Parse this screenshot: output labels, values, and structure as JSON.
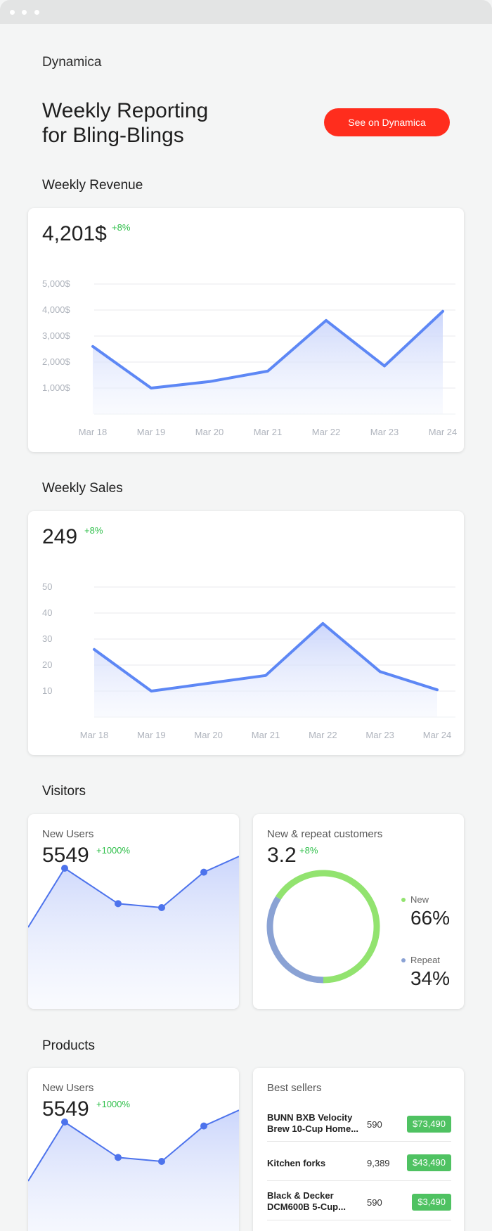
{
  "brand": "Dynamica",
  "headline": {
    "line1": "Weekly Reporting",
    "line2": "for Bling-Blings"
  },
  "cta_label": "See on Dynamica",
  "colors": {
    "accent": "#ff2d1d",
    "line": "#5d87f5",
    "positive": "#2fbf4a",
    "donut_new": "#92e36f",
    "donut_repeat": "#8aa2d4",
    "badge": "#4fc262"
  },
  "revenue": {
    "title": "Weekly Revenue",
    "value": "4,201$",
    "delta": "+8%"
  },
  "sales": {
    "title": "Weekly Sales",
    "value": "249",
    "delta": "+8%"
  },
  "visitors": {
    "title": "Visitors",
    "new_users": {
      "label": "New Users",
      "value": "5549",
      "delta": "+1000%"
    },
    "customers": {
      "label": "New & repeat customers",
      "value": "3.2",
      "delta": "+8%",
      "new_label": "New",
      "new_pct": "66%",
      "repeat_label": "Repeat",
      "repeat_pct": "34%"
    }
  },
  "products": {
    "title": "Products",
    "new_users": {
      "label": "New Users",
      "value": "5549",
      "delta": "+1000%"
    },
    "best_sellers": {
      "label": "Best sellers",
      "rows": [
        {
          "name": "BUNN BXB Velocity Brew 10-Cup Home...",
          "qty": "590",
          "price": "$73,490"
        },
        {
          "name": "Kitchen forks",
          "qty": "9,389",
          "price": "$43,490"
        },
        {
          "name": "Black & Decker DCM600B 5-Cup...",
          "qty": "590",
          "price": "$3,490"
        }
      ]
    }
  },
  "chart_data": [
    {
      "type": "area",
      "categories": [
        "Mar 18",
        "Mar 19",
        "Mar 20",
        "Mar 21",
        "Mar 22",
        "Mar 23",
        "Mar 24"
      ],
      "values": [
        2600,
        1000,
        1250,
        1650,
        3600,
        1850,
        3950
      ],
      "y_ticks": [
        "1,000$",
        "2,000$",
        "3,000$",
        "4,000$",
        "5,000$"
      ],
      "ylim": [
        0,
        5000
      ],
      "grid": true
    },
    {
      "type": "area",
      "categories": [
        "Mar 18",
        "Mar 19",
        "Mar 20",
        "Mar 21",
        "Mar 22",
        "Mar 23",
        "Mar 24"
      ],
      "values": [
        26,
        10,
        13,
        16,
        36,
        17.5,
        10.5
      ],
      "y_ticks": [
        "10",
        "20",
        "30",
        "40",
        "50"
      ],
      "ylim": [
        0,
        50
      ],
      "grid": true
    },
    {
      "type": "line",
      "values": [
        30,
        60,
        42,
        40,
        58,
        66
      ],
      "grid": false
    },
    {
      "type": "pie",
      "categories": [
        "New",
        "Repeat"
      ],
      "values": [
        66,
        34
      ]
    },
    {
      "type": "line",
      "values": [
        30,
        60,
        42,
        40,
        58,
        66
      ],
      "grid": false
    }
  ]
}
